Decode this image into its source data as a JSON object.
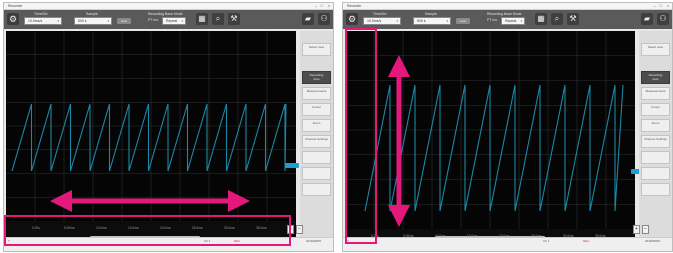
{
  "window_title": "Recorder",
  "toolbar": {
    "time_div_label": "Time/Div",
    "time_div_value": "10.0ms/s",
    "sample_label": "Sample",
    "sample_value": "500 k",
    "small_button": "Auto",
    "recording_label": "Recording Base Mode",
    "recording_sub": "PT mo",
    "recording_value": "Repeat"
  },
  "right_panel": {
    "top_right_label": "Recording",
    "top_right_value": "Auto",
    "buttons": [
      "Select view",
      "Measurements",
      "Cursor",
      "Zoom",
      "Channel Settings",
      "",
      "",
      ""
    ]
  },
  "time_ticks": [
    "0.00s",
    "5.00ms",
    "10.0ms",
    "15.0ms",
    "20.0ms",
    "25.0ms",
    "30.0ms",
    "35.0ms"
  ],
  "status": {
    "left_icon": "?",
    "mid": "Ch 1",
    "pink": "REC",
    "right": "2016/08/05"
  },
  "nav": {
    "zoom_in": "+",
    "zoom_out": "−"
  },
  "colors": {
    "waveform": "#1c87a5",
    "highlight": "#e2197b",
    "grid": "#2e2e2e",
    "cursor": "#1a9fd0"
  },
  "annotation": {
    "left": "horizontal-arrow",
    "right": "vertical-arrow"
  }
}
